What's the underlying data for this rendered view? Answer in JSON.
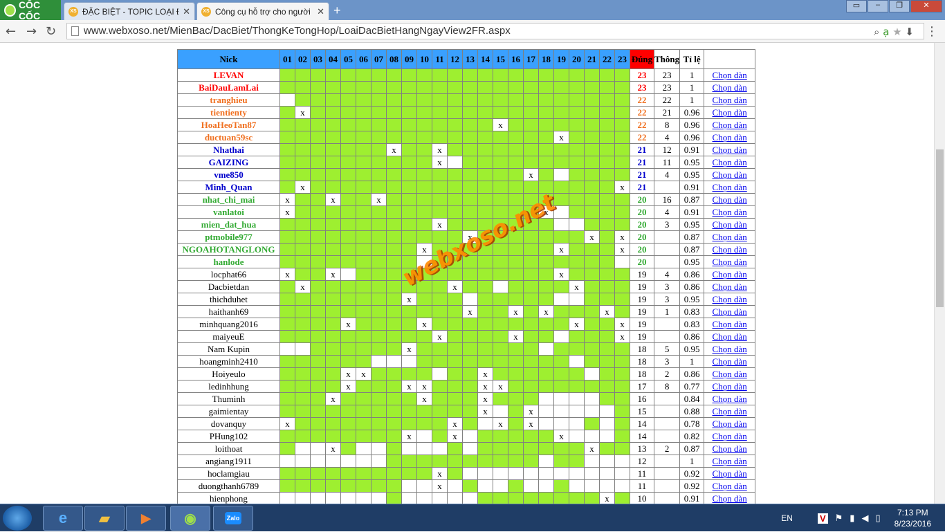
{
  "browser": {
    "brand": "CỐC CỐC",
    "tabs": [
      {
        "label": "ĐẶC BIỆT - TOPIC LOẠI Đ",
        "active": false
      },
      {
        "label": "Công cụ hỗ trợ cho người",
        "active": true
      }
    ],
    "url": "www.webxoso.net/MienBac/DacBiet/ThongKeTongHop/LoaiDacBietHangNgayView2FR.aspx"
  },
  "table": {
    "headers": {
      "nick": "Nick",
      "days": [
        "01",
        "02",
        "03",
        "04",
        "05",
        "06",
        "07",
        "08",
        "09",
        "10",
        "11",
        "12",
        "13",
        "14",
        "15",
        "16",
        "17",
        "18",
        "19",
        "20",
        "21",
        "22",
        "23"
      ],
      "dung": "Đúng",
      "thong": "Thông",
      "tile": "Tỉ lệ"
    },
    "action_label": "Chọn dàn",
    "colors": {
      "red": "#ff0000",
      "orange": "#f07020",
      "blue": "#0000cc",
      "green": "#33aa33",
      "black": "#000000"
    },
    "rows": [
      {
        "nick": "LEVAN",
        "color": "red",
        "bold": true,
        "x": [],
        "w": [],
        "dung": "23",
        "thong": "23",
        "tile": "1"
      },
      {
        "nick": "BaiDauLamLai",
        "color": "red",
        "bold": true,
        "x": [],
        "w": [],
        "dung": "23",
        "thong": "23",
        "tile": "1"
      },
      {
        "nick": "tranghieu",
        "color": "orange",
        "bold": true,
        "x": [],
        "w": [
          1
        ],
        "dung": "22",
        "thong": "22",
        "tile": "1"
      },
      {
        "nick": "tientienty",
        "color": "orange",
        "bold": true,
        "x": [
          2
        ],
        "w": [
          2
        ],
        "dung": "22",
        "thong": "21",
        "tile": "0.96"
      },
      {
        "nick": "HoaHeoTan87",
        "color": "orange",
        "bold": true,
        "x": [
          15
        ],
        "w": [
          15
        ],
        "dung": "22",
        "thong": "8",
        "tile": "0.96"
      },
      {
        "nick": "ductuan59sc",
        "color": "orange",
        "bold": true,
        "x": [
          19
        ],
        "w": [
          19
        ],
        "dung": "22",
        "thong": "4",
        "tile": "0.96"
      },
      {
        "nick": "Nhathai",
        "color": "blue",
        "bold": true,
        "x": [
          8,
          11
        ],
        "w": [
          8,
          11
        ],
        "dung": "21",
        "thong": "12",
        "tile": "0.91"
      },
      {
        "nick": "GAIZING",
        "color": "blue",
        "bold": true,
        "x": [
          11
        ],
        "w": [
          11,
          12
        ],
        "dung": "21",
        "thong": "11",
        "tile": "0.95"
      },
      {
        "nick": "vme850",
        "color": "blue",
        "bold": true,
        "x": [
          17
        ],
        "w": [
          17,
          19
        ],
        "dung": "21",
        "thong": "4",
        "tile": "0.95"
      },
      {
        "nick": "Minh_Quan",
        "color": "blue",
        "bold": true,
        "x": [
          2,
          23
        ],
        "w": [
          2,
          23
        ],
        "dung": "21",
        "thong": "",
        "tile": "0.91"
      },
      {
        "nick": "nhat_chi_mai",
        "color": "green",
        "bold": true,
        "x": [
          1,
          4,
          7
        ],
        "w": [
          1,
          4,
          7
        ],
        "dung": "20",
        "thong": "16",
        "tile": "0.87"
      },
      {
        "nick": "vanlatoi",
        "color": "green",
        "bold": true,
        "x": [
          1,
          18
        ],
        "w": [
          1,
          18,
          19
        ],
        "dung": "20",
        "thong": "4",
        "tile": "0.91"
      },
      {
        "nick": "mien_dat_hua",
        "color": "green",
        "bold": true,
        "x": [
          11
        ],
        "w": [
          11,
          19,
          20
        ],
        "dung": "20",
        "thong": "3",
        "tile": "0.95"
      },
      {
        "nick": "ptmobile977",
        "color": "green",
        "bold": true,
        "x": [
          13,
          21,
          23
        ],
        "w": [
          13,
          21,
          23
        ],
        "dung": "20",
        "thong": "",
        "tile": "0.87"
      },
      {
        "nick": "NGOAHOTANGLONG",
        "color": "green",
        "bold": true,
        "x": [
          10,
          19,
          23
        ],
        "w": [
          10,
          19,
          23
        ],
        "dung": "20",
        "thong": "",
        "tile": "0.87"
      },
      {
        "nick": "hanlode",
        "color": "green",
        "bold": true,
        "x": [],
        "w": [
          10,
          23
        ],
        "dung": "20",
        "thong": "",
        "tile": "0.95"
      },
      {
        "nick": "locphat66",
        "color": "black",
        "bold": false,
        "x": [
          1,
          4,
          19
        ],
        "w": [
          1,
          4,
          5,
          19
        ],
        "dung": "19",
        "thong": "4",
        "tile": "0.86"
      },
      {
        "nick": "Dacbietdan",
        "color": "black",
        "bold": false,
        "x": [
          2,
          12,
          20
        ],
        "w": [
          2,
          12,
          15,
          20
        ],
        "dung": "19",
        "thong": "3",
        "tile": "0.86"
      },
      {
        "nick": "thichduhet",
        "color": "black",
        "bold": false,
        "x": [
          9
        ],
        "w": [
          9,
          13,
          19,
          20
        ],
        "dung": "19",
        "thong": "3",
        "tile": "0.95"
      },
      {
        "nick": "haithanh69",
        "color": "black",
        "bold": false,
        "x": [
          13,
          16,
          18,
          22
        ],
        "w": [
          13,
          16,
          18,
          22
        ],
        "dung": "19",
        "thong": "1",
        "tile": "0.83"
      },
      {
        "nick": "minhquang2016",
        "color": "black",
        "bold": false,
        "x": [
          5,
          10,
          20,
          23
        ],
        "w": [
          5,
          10,
          20,
          23
        ],
        "dung": "19",
        "thong": "",
        "tile": "0.83"
      },
      {
        "nick": "maiyeuE",
        "color": "black",
        "bold": false,
        "x": [
          11,
          16,
          23
        ],
        "w": [
          11,
          16,
          19,
          23
        ],
        "dung": "19",
        "thong": "",
        "tile": "0.86"
      },
      {
        "nick": "Nam Kupin",
        "color": "black",
        "bold": false,
        "x": [
          9
        ],
        "w": [
          1,
          2,
          9,
          18
        ],
        "dung": "18",
        "thong": "5",
        "tile": "0.95"
      },
      {
        "nick": "hoangminh2410",
        "color": "black",
        "bold": false,
        "x": [],
        "w": [
          7,
          8,
          9,
          20
        ],
        "dung": "18",
        "thong": "3",
        "tile": "1"
      },
      {
        "nick": "Hoiyeulo",
        "color": "black",
        "bold": false,
        "x": [
          5,
          6,
          14
        ],
        "w": [
          5,
          6,
          11,
          14,
          21
        ],
        "dung": "18",
        "thong": "2",
        "tile": "0.86"
      },
      {
        "nick": "ledinhhung",
        "color": "black",
        "bold": false,
        "x": [
          5,
          9,
          10,
          14,
          15
        ],
        "w": [
          5,
          9,
          10,
          14,
          15
        ],
        "dung": "17",
        "thong": "8",
        "tile": "0.77"
      },
      {
        "nick": "Thuminh",
        "color": "black",
        "bold": false,
        "x": [
          4,
          10,
          14
        ],
        "w": [
          4,
          10,
          14,
          18,
          19,
          20,
          21
        ],
        "dung": "16",
        "thong": "",
        "tile": "0.84"
      },
      {
        "nick": "gaimientay",
        "color": "black",
        "bold": false,
        "x": [
          14,
          17
        ],
        "w": [
          14,
          15,
          17,
          18,
          19,
          20,
          21,
          22
        ],
        "dung": "15",
        "thong": "",
        "tile": "0.88"
      },
      {
        "nick": "dovanquy",
        "color": "black",
        "bold": false,
        "x": [
          1,
          12,
          15,
          17
        ],
        "w": [
          1,
          12,
          14,
          15,
          17,
          18,
          19,
          20,
          22
        ],
        "dung": "14",
        "thong": "",
        "tile": "0.78"
      },
      {
        "nick": "PHung102",
        "color": "black",
        "bold": false,
        "x": [
          9,
          12,
          19
        ],
        "w": [
          9,
          10,
          12,
          13,
          19,
          20,
          21,
          22
        ],
        "dung": "14",
        "thong": "",
        "tile": "0.82"
      },
      {
        "nick": "loithoat",
        "color": "black",
        "bold": false,
        "x": [
          4,
          21
        ],
        "w": [
          2,
          3,
          4,
          6,
          7,
          9,
          10,
          11,
          13,
          21
        ],
        "dung": "13",
        "thong": "2",
        "tile": "0.87"
      },
      {
        "nick": "angiang1911",
        "color": "black",
        "bold": false,
        "x": [],
        "w": [
          1,
          2,
          3,
          4,
          5,
          6,
          7,
          18,
          21,
          22,
          23
        ],
        "dung": "12",
        "thong": "",
        "tile": "1"
      },
      {
        "nick": "hoclamgiau",
        "color": "black",
        "bold": false,
        "x": [
          11
        ],
        "w": [
          11,
          13,
          14,
          15,
          16,
          17,
          18,
          19,
          20,
          21,
          22,
          23
        ],
        "dung": "11",
        "thong": "",
        "tile": "0.92"
      },
      {
        "nick": "duongthanh6789",
        "color": "black",
        "bold": false,
        "x": [
          11
        ],
        "w": [
          9,
          10,
          11,
          12,
          14,
          15,
          17,
          18,
          20,
          21,
          22,
          23
        ],
        "dung": "11",
        "thong": "",
        "tile": "0.92"
      },
      {
        "nick": "hienphong",
        "color": "black",
        "bold": false,
        "x": [
          22
        ],
        "w": [
          1,
          2,
          3,
          4,
          5,
          6,
          7,
          9,
          10,
          11,
          12,
          13,
          22
        ],
        "dung": "10",
        "thong": "",
        "tile": "0.91"
      }
    ]
  },
  "watermark": "webxoso.net",
  "taskbar": {
    "zalo": "Zalo",
    "lang": "EN",
    "time": "7:13 PM",
    "date": "8/23/2016"
  }
}
